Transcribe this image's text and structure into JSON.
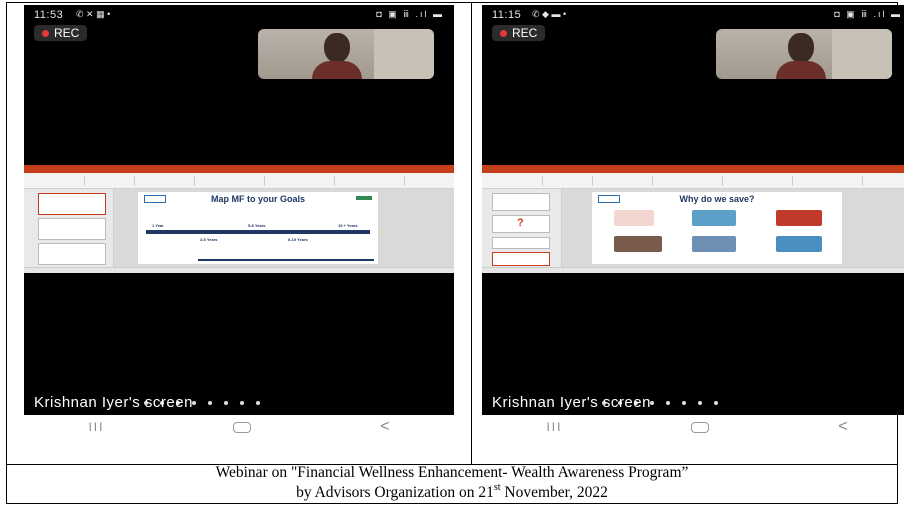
{
  "left_panel": {
    "status_time": "11:53",
    "status_icons_left": "✆ ✕ ▦ •",
    "status_icons_right": "◘ ▣ ⅲ .ıl ▬",
    "rec_label": "REC",
    "slide_title": "Map MF to your Goals",
    "timeline_labels": [
      "1 Year",
      "3-5 Years",
      "5-8 Years",
      "8-15 Years",
      "15 + Years"
    ],
    "caption": "Krishnan Iyer's screen"
  },
  "right_panel": {
    "status_time": "11:15",
    "status_icons_left": "✆ ◆ ▬ •",
    "status_icons_right": "◘ ▣ ⅲ .ıl ▬",
    "rec_label": "REC",
    "slide_title": "Why do we save?",
    "caption": "Krishnan Iyer's screen"
  },
  "footer": {
    "line1": "Webinar on \"Financial Wellness Enhancement- Wealth Awareness Program”",
    "line2_prefix": "by Advisors Organization on  21",
    "line2_sup": "st",
    "line2_suffix": " November, 2022"
  },
  "colors": {
    "rec_dot": "#e53935",
    "ppt_ribbon": "#c43e1c",
    "slide_title": "#1f3864"
  },
  "icons": [
    "recents-icon",
    "home-icon",
    "back-icon",
    "rec-dot-icon"
  ]
}
